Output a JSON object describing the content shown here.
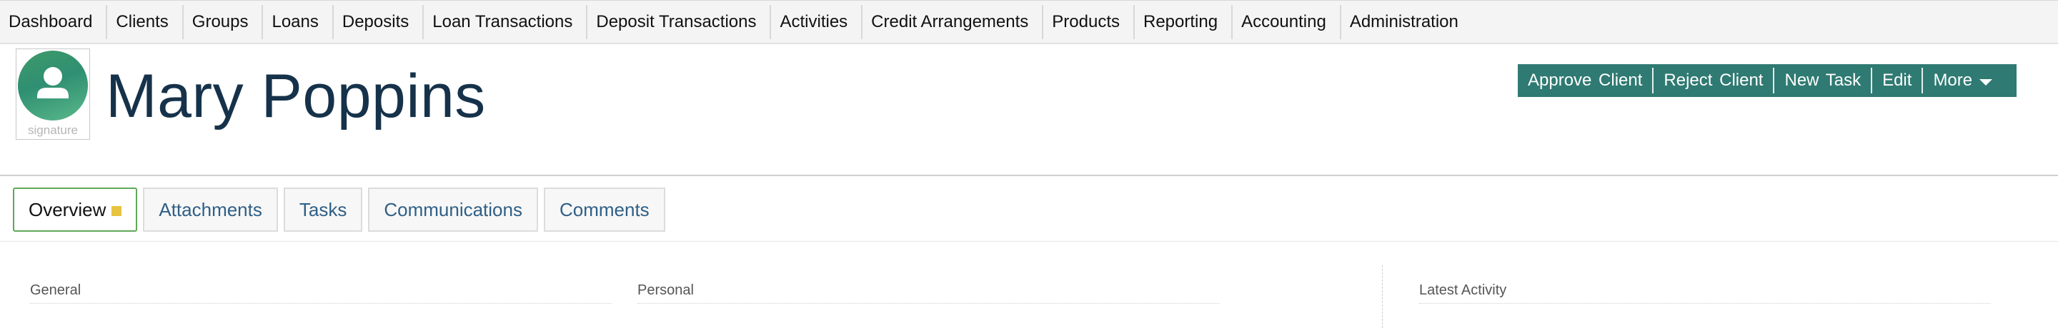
{
  "nav": {
    "items": [
      {
        "label": "Dashboard"
      },
      {
        "label": "Clients"
      },
      {
        "label": "Groups"
      },
      {
        "label": "Loans"
      },
      {
        "label": "Deposits"
      },
      {
        "label": "Loan Transactions"
      },
      {
        "label": "Deposit Transactions"
      },
      {
        "label": "Activities"
      },
      {
        "label": "Credit Arrangements"
      },
      {
        "label": "Products"
      },
      {
        "label": "Reporting"
      },
      {
        "label": "Accounting"
      },
      {
        "label": "Administration"
      }
    ]
  },
  "client": {
    "name": "Mary Poppins",
    "signature_label": "signature",
    "avatar_icon": "user-icon"
  },
  "actions": {
    "approve": "Approve Client",
    "reject": "Reject Client",
    "new_task": "New Task",
    "edit": "Edit",
    "more": "More",
    "background_color": "#2f7a72"
  },
  "tabs": [
    {
      "label": "Overview",
      "active": true
    },
    {
      "label": "Attachments"
    },
    {
      "label": "Tasks"
    },
    {
      "label": "Communications"
    },
    {
      "label": "Comments"
    }
  ],
  "sections": {
    "general": "General",
    "personal": "Personal",
    "latest_activity": "Latest Activity"
  },
  "colors": {
    "active_tab_border": "#5fa85a",
    "tab_marker": "#e7c33f",
    "title_text": "#16324a"
  }
}
